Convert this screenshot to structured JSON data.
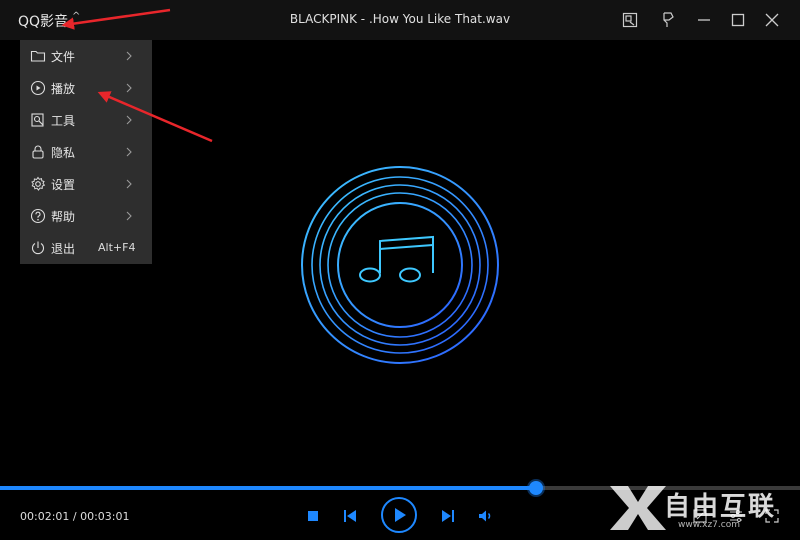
{
  "app": {
    "title": "QQ影音",
    "file_title": "BLACKPINK - .How You Like That.wav"
  },
  "menu": {
    "items": [
      {
        "label": "文件",
        "icon": "folder-icon",
        "has_submenu": true
      },
      {
        "label": "播放",
        "icon": "play-circle-icon",
        "has_submenu": true
      },
      {
        "label": "工具",
        "icon": "tools-icon",
        "has_submenu": true
      },
      {
        "label": "隐私",
        "icon": "lock-icon",
        "has_submenu": true
      },
      {
        "label": "设置",
        "icon": "gear-icon",
        "has_submenu": true
      },
      {
        "label": "帮助",
        "icon": "help-icon",
        "has_submenu": true
      },
      {
        "label": "退出",
        "icon": "power-icon",
        "shortcut": "Alt+F4"
      }
    ]
  },
  "player": {
    "time": "00:02:01 / 00:03:01",
    "progress_fraction": 0.67
  },
  "colors": {
    "accent": "#1e88ff",
    "titlebar": "#121212",
    "menu_bg": "#2e2e2e",
    "annotation_arrow": "#e8262b"
  },
  "watermark": {
    "text": "自由互联",
    "url": "www.xz7.com"
  }
}
